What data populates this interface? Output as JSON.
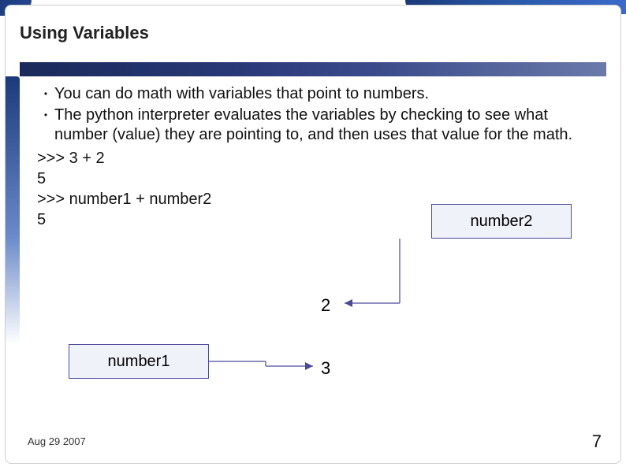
{
  "title": "Using Variables",
  "bullets": [
    "You can do math with variables that point to numbers.",
    "The python interpreter evaluates the variables by checking to see what number (value) they are pointing to, and then uses that value for the math."
  ],
  "code": {
    "line1": ">>> 3 + 2",
    "line2": "5",
    "line3": ">>> number1 + number2",
    "line4": "5"
  },
  "boxes": {
    "number1": "number1",
    "number2": "number2"
  },
  "values": {
    "v2": "2",
    "v3": "3"
  },
  "footer": {
    "date": "Aug 29 2007",
    "page": "7"
  }
}
